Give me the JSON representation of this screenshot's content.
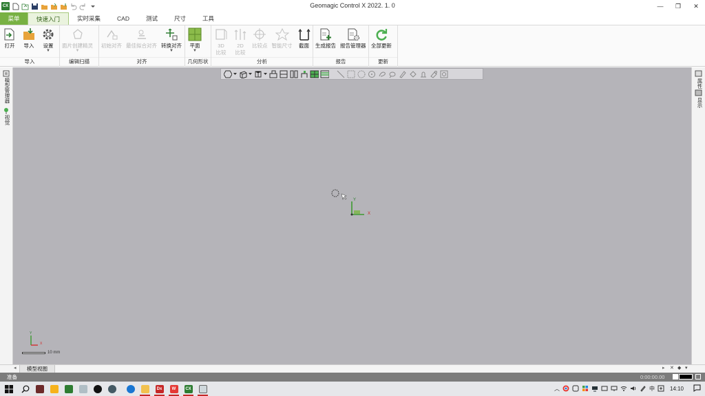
{
  "window": {
    "title": "Geomagic Control X 2022. 1. 0",
    "app_logo_text": "CX",
    "minimize_glyph": "—",
    "restore_glyph": "❐",
    "close_glyph": "✕"
  },
  "tabs": [
    {
      "label": "菜单"
    },
    {
      "label": "快速入门"
    },
    {
      "label": "实时采集"
    },
    {
      "label": "CAD"
    },
    {
      "label": "测试"
    },
    {
      "label": "尺寸"
    },
    {
      "label": "工具"
    }
  ],
  "ribbon": {
    "import_group": {
      "label": "导入",
      "open": "打开",
      "import": "导入",
      "settings": "设置"
    },
    "scan_group": {
      "label": "编辑扫描",
      "mesh_refine": "面片创建精灵"
    },
    "align_group": {
      "label": "对齐",
      "initial": "初始对齐",
      "best_fit": "最佳拟合对齐",
      "transform": "转换对齐"
    },
    "geometry_group": {
      "label": "几何形状",
      "plane": "平面"
    },
    "analysis_group": {
      "label": "分析",
      "compare_3d_a": "3D",
      "compare_3d_b": "比较",
      "compare_2d_a": "2D",
      "compare_2d_b": "比较",
      "compare_point": "比较点",
      "smart_dim": "智能尺寸",
      "section": "截面"
    },
    "report_group": {
      "label": "报告",
      "generate": "生成报告",
      "manager": "报告管理器"
    },
    "update_group": {
      "label": "更新",
      "update_all": "全部更新"
    }
  },
  "left_panel": {
    "tree": "模型管理器",
    "tool": "视觉"
  },
  "right_panel": {
    "props": "属性",
    "display": "显示"
  },
  "viewport": {
    "axis_y": "Y",
    "axis_x": "X",
    "axis_label_small": "Y",
    "axis_label_small_x": "X",
    "scale_label": "10 mm"
  },
  "view_tabs": {
    "model_view": "模型视图"
  },
  "status": {
    "left": "准备",
    "time": "0:00:00.00"
  },
  "taskbar": {
    "time": "14:10",
    "ime": "中",
    "apps": [
      "Wo",
      "Dx",
      "W",
      "CX"
    ]
  },
  "colors": {
    "accent_green": "#78b143",
    "viewport_bg": "#b5b4b9",
    "status_bg": "#7c7c7c"
  }
}
